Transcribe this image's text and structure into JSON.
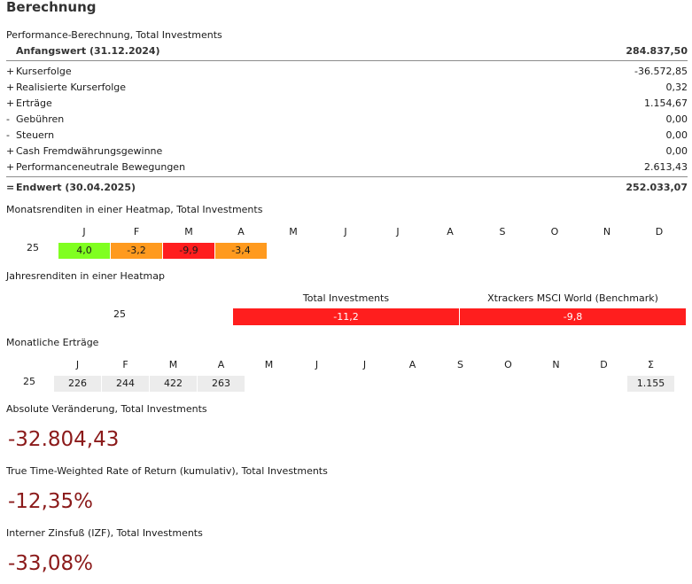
{
  "title": "Berechnung",
  "performance": {
    "label": "Performance-Berechnung, Total Investments",
    "start": {
      "label": "Anfangswert (31.12.2024)",
      "value": "284.837,50"
    },
    "rows": [
      {
        "op": "+",
        "label": "Kurserfolge",
        "value": "-36.572,85"
      },
      {
        "op": "+",
        "label": "Realisierte Kurserfolge",
        "value": "0,32"
      },
      {
        "op": "+",
        "label": "Erträge",
        "value": "1.154,67"
      },
      {
        "op": "-",
        "label": "Gebühren",
        "value": "0,00"
      },
      {
        "op": "-",
        "label": "Steuern",
        "value": "0,00"
      },
      {
        "op": "+",
        "label": "Cash Fremdwährungsgewinne",
        "value": "0,00"
      },
      {
        "op": "+",
        "label": "Performanceneutrale Bewegungen",
        "value": "2.613,43"
      }
    ],
    "end": {
      "op": "=",
      "label": "Endwert (30.04.2025)",
      "value": "252.033,07"
    }
  },
  "monthly_heatmap": {
    "label": "Monatsrenditen in einer Heatmap, Total Investments",
    "months": [
      "J",
      "F",
      "M",
      "A",
      "M",
      "J",
      "J",
      "A",
      "S",
      "O",
      "N",
      "D"
    ],
    "year": "25",
    "values": [
      "4,0",
      "-3,2",
      "-9,9",
      "-3,4"
    ],
    "colors": [
      "#80ff20",
      "#ff9a1e",
      "#ff1e1e",
      "#ff9a1e"
    ]
  },
  "annual_heatmap": {
    "label": "Jahresrenditen in einer Heatmap",
    "columns": [
      "Total Investments",
      "Xtrackers MSCI World (Benchmark)"
    ],
    "year": "25",
    "values": [
      "-11,2",
      "-9,8"
    ],
    "color": "#ff1e1e"
  },
  "monthly_income": {
    "label": "Monatliche Erträge",
    "months": [
      "J",
      "F",
      "M",
      "A",
      "M",
      "J",
      "J",
      "A",
      "S",
      "O",
      "N",
      "D",
      "Σ"
    ],
    "year": "25",
    "values": [
      "226",
      "244",
      "422",
      "263"
    ],
    "total": "1.155"
  },
  "absolute_change": {
    "label": "Absolute Veränderung, Total Investments",
    "value": "-32.804,43"
  },
  "ttwror": {
    "label": "True Time-Weighted Rate of Return (kumulativ), Total Investments",
    "value": "-12,35%"
  },
  "irr": {
    "label": "Interner Zinsfuß (IZF), Total Investments",
    "value": "-33,08%"
  }
}
